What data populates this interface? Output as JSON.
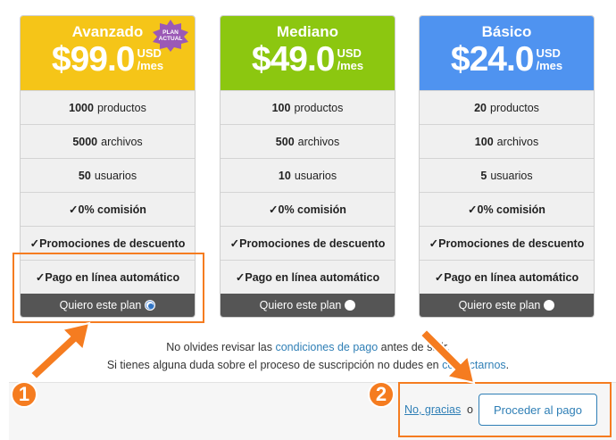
{
  "plans": [
    {
      "name": "Avanzado",
      "price": "$99.0",
      "currency": "USD",
      "period": "/mes",
      "color": "#f5c518",
      "badge": [
        "PLAN",
        "ACTUAL"
      ],
      "features": [
        {
          "value": "1000",
          "label": "productos"
        },
        {
          "value": "5000",
          "label": "archivos"
        },
        {
          "value": "50",
          "label": "usuarios"
        }
      ],
      "checks": [
        "✓0% comisión",
        "✓Promociones de descuento",
        "✓Pago en línea automático"
      ],
      "cta": "Quiero este plan",
      "selected": true
    },
    {
      "name": "Mediano",
      "price": "$49.0",
      "currency": "USD",
      "period": "/mes",
      "color": "#8cc710",
      "features": [
        {
          "value": "100",
          "label": "productos"
        },
        {
          "value": "500",
          "label": "archivos"
        },
        {
          "value": "10",
          "label": "usuarios"
        }
      ],
      "checks": [
        "✓0% comisión",
        "✓Promociones de descuento",
        "✓Pago en línea automático"
      ],
      "cta": "Quiero este plan",
      "selected": false
    },
    {
      "name": "Básico",
      "price": "$24.0",
      "currency": "USD",
      "period": "/mes",
      "color": "#4f93f0",
      "features": [
        {
          "value": "20",
          "label": "productos"
        },
        {
          "value": "100",
          "label": "archivos"
        },
        {
          "value": "5",
          "label": "usuarios"
        }
      ],
      "checks": [
        "✓0% comisión",
        "✓Promociones de descuento",
        "✓Pago en línea automático"
      ],
      "cta": "Quiero este plan",
      "selected": false
    }
  ],
  "notice": {
    "line1_prefix": "No olvides revisar las",
    "line1_link": "condiciones de pago",
    "line1_suffix": "antes de salir.",
    "line2_prefix": "Si tienes alguna duda sobre el proceso de suscripción no dudes en",
    "line2_link": "contactarnos",
    "line2_suffix": "."
  },
  "footer": {
    "decline_link": "No, gracias",
    "or_text": "o",
    "proceed_button": "Proceder al pago"
  },
  "annotations": {
    "step1": "1",
    "step2": "2",
    "accent_color": "#f57c20"
  }
}
